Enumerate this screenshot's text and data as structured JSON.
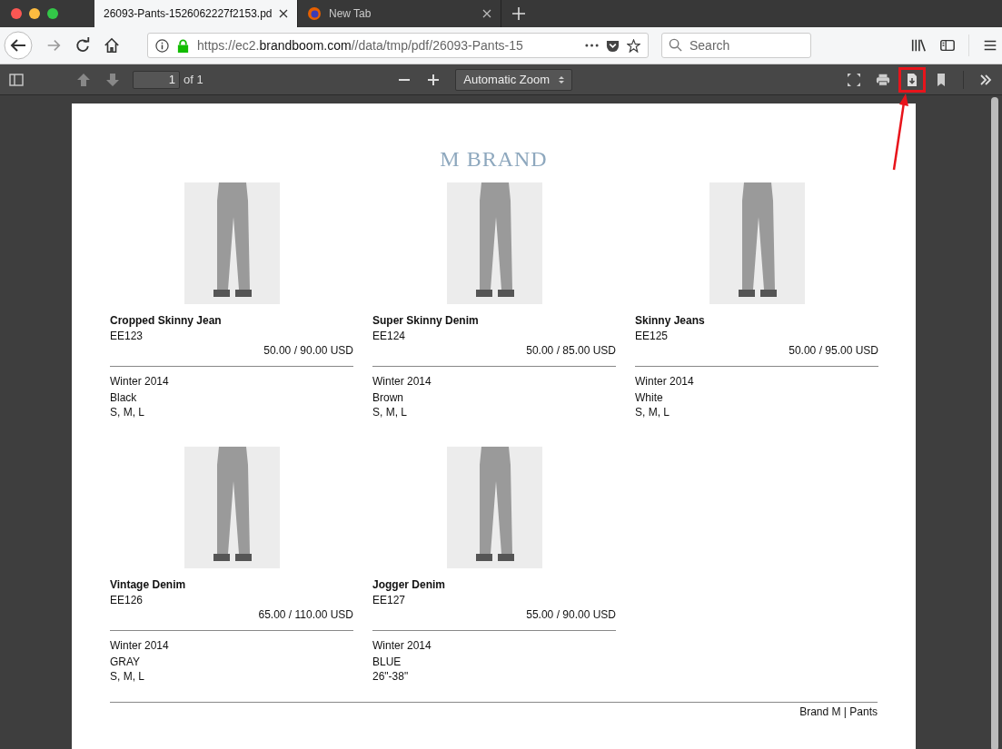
{
  "tabs": [
    {
      "title": "26093-Pants-1526062227f2153.pd",
      "selected": true
    },
    {
      "title": "New Tab",
      "selected": false
    }
  ],
  "address_bar": {
    "url_scheme": "https://ec2.",
    "url_domain": "brandboom.com",
    "url_path": "//data/tmp/pdf/26093-Pants-15"
  },
  "search": {
    "placeholder": "Search"
  },
  "pdf_toolbar": {
    "page_number": "1",
    "page_count": "of 1",
    "zoom": "Automatic Zoom",
    "download_highlighted": true
  },
  "document": {
    "title": "M BRAND",
    "products": [
      {
        "name": "Cropped Skinny Jean",
        "code": "EE123",
        "price": "50.00 / 90.00 USD",
        "season": "Winter 2014",
        "shade": "Black",
        "sizes": "S, M, L"
      },
      {
        "name": "Super Skinny Denim",
        "code": "EE124",
        "price": "50.00 / 85.00 USD",
        "season": "Winter 2014",
        "shade": "Brown",
        "sizes": "S, M, L"
      },
      {
        "name": "Skinny Jeans",
        "code": "EE125",
        "price": "50.00 / 95.00 USD",
        "season": "Winter 2014",
        "shade": "White",
        "sizes": "S, M, L"
      },
      {
        "name": "Vintage Denim",
        "code": "EE126",
        "price": "65.00 / 110.00 USD",
        "season": "Winter 2014",
        "shade": "GRAY",
        "sizes": "S, M, L"
      },
      {
        "name": "Jogger Denim",
        "code": "EE127",
        "price": "55.00 / 90.00 USD",
        "season": "Winter 2014",
        "shade": "BLUE",
        "sizes": "26\"-38\""
      }
    ],
    "footer": "Brand M | Pants"
  }
}
